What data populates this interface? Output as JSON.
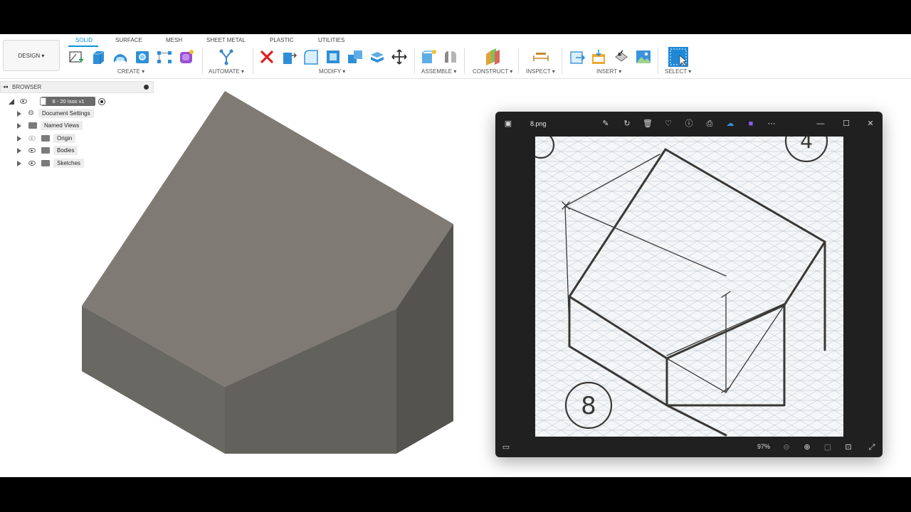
{
  "ribbon": {
    "workspace": "DESIGN ▾",
    "tabs": [
      "SOLID",
      "SURFACE",
      "MESH",
      "SHEET METAL",
      "PLASTIC",
      "UTILITIES"
    ],
    "groups": {
      "create": "CREATE ▾",
      "automate": "AUTOMATE ▾",
      "modify": "MODIFY ▾",
      "assemble": "ASSEMBLE ▾",
      "construct": "CONSTRUCT ▾",
      "inspect": "INSPECT ▾",
      "insert": "INSERT ▾",
      "select": "SELECT ▾"
    },
    "accent": "#0696d7"
  },
  "browser": {
    "title": "BROWSER",
    "root": "8 - 20 Isos v1",
    "items": [
      "Document Settings",
      "Named Views",
      "Origin",
      "Bodies",
      "Sketches"
    ]
  },
  "photos": {
    "filename": "8.png",
    "zoom": "97%",
    "sketch_numbers": [
      "4",
      "8"
    ]
  },
  "colors": {
    "model_top": "#7f7a73",
    "model_left": "#6a6862",
    "model_front": "#63615b",
    "model_right": "#55534f"
  }
}
